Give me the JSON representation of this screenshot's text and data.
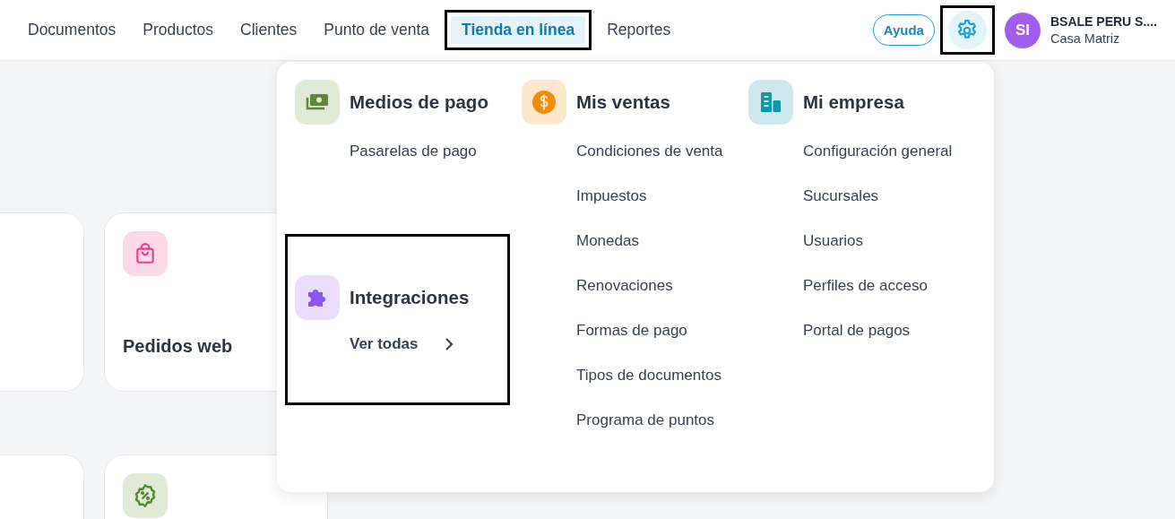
{
  "nav": [
    {
      "label": "Documentos",
      "selected": false,
      "highlighted": false
    },
    {
      "label": "Productos",
      "selected": false,
      "highlighted": false
    },
    {
      "label": "Clientes",
      "selected": false,
      "highlighted": false
    },
    {
      "label": "Punto de venta",
      "selected": false,
      "highlighted": false
    },
    {
      "label": "Tienda en línea",
      "selected": true,
      "highlighted": true
    },
    {
      "label": "Reportes",
      "selected": false,
      "highlighted": false
    }
  ],
  "help_button": "Ayuda",
  "settings_button": {
    "highlighted": true
  },
  "account": {
    "initials": "SI",
    "name": "BSALE PERU S....",
    "branch": "Casa Matriz"
  },
  "cards": [
    {
      "kind": "blank"
    },
    {
      "kind": "shop",
      "title": "Pedidos web"
    },
    {
      "kind": "blank"
    },
    {
      "kind": "discount"
    }
  ],
  "menu": {
    "columns": [
      {
        "sections": [
          {
            "kind": "money",
            "title": "Medios de pago",
            "items": [
              "Pasarelas de pago"
            ],
            "highlighted": false
          },
          {
            "kind": "puzzle",
            "title": "Integraciones",
            "link": "Ver todas",
            "highlighted": true
          }
        ]
      },
      {
        "sections": [
          {
            "kind": "dollar",
            "title": "Mis ventas",
            "items": [
              "Condiciones de venta",
              "Impuestos",
              "Monedas",
              "Renovaciones",
              "Formas de pago",
              "Tipos de documentos",
              "Programa de puntos"
            ],
            "highlighted": false
          }
        ]
      },
      {
        "sections": [
          {
            "kind": "building",
            "title": "Mi empresa",
            "items": [
              "Configuración general",
              "Sucursales",
              "Usuarios",
              "Perfiles de acceso",
              "Portal de pagos"
            ],
            "highlighted": false
          }
        ]
      }
    ]
  }
}
